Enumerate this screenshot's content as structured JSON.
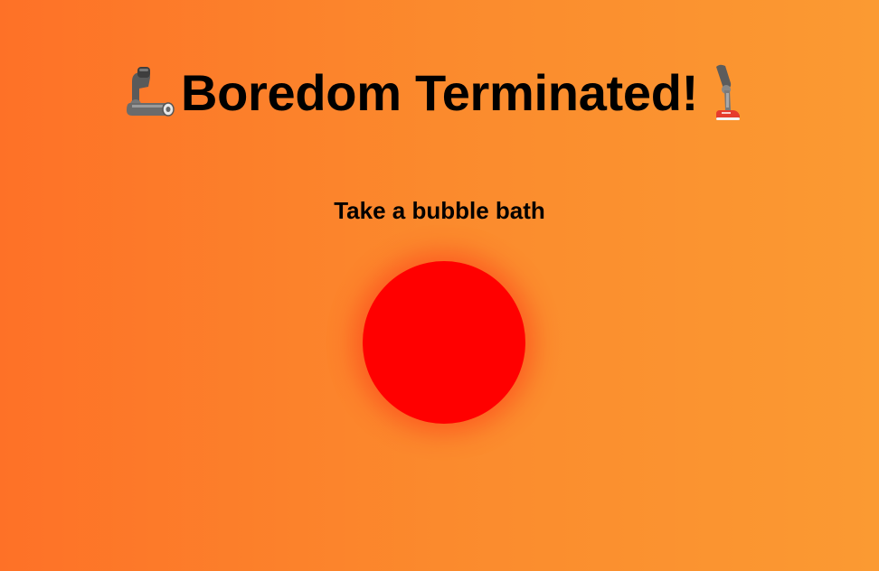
{
  "header": {
    "title": "Boredom Terminated!",
    "left_emoji": "mechanical-arm-icon",
    "right_emoji": "mechanical-leg-icon"
  },
  "activity": {
    "text": "Take a bubble bath"
  },
  "bubble": {
    "color": "#ff0000",
    "shape": "circle"
  },
  "colors": {
    "background_start": "#fe7127",
    "background_end": "#fb9a32",
    "text": "#000000"
  }
}
